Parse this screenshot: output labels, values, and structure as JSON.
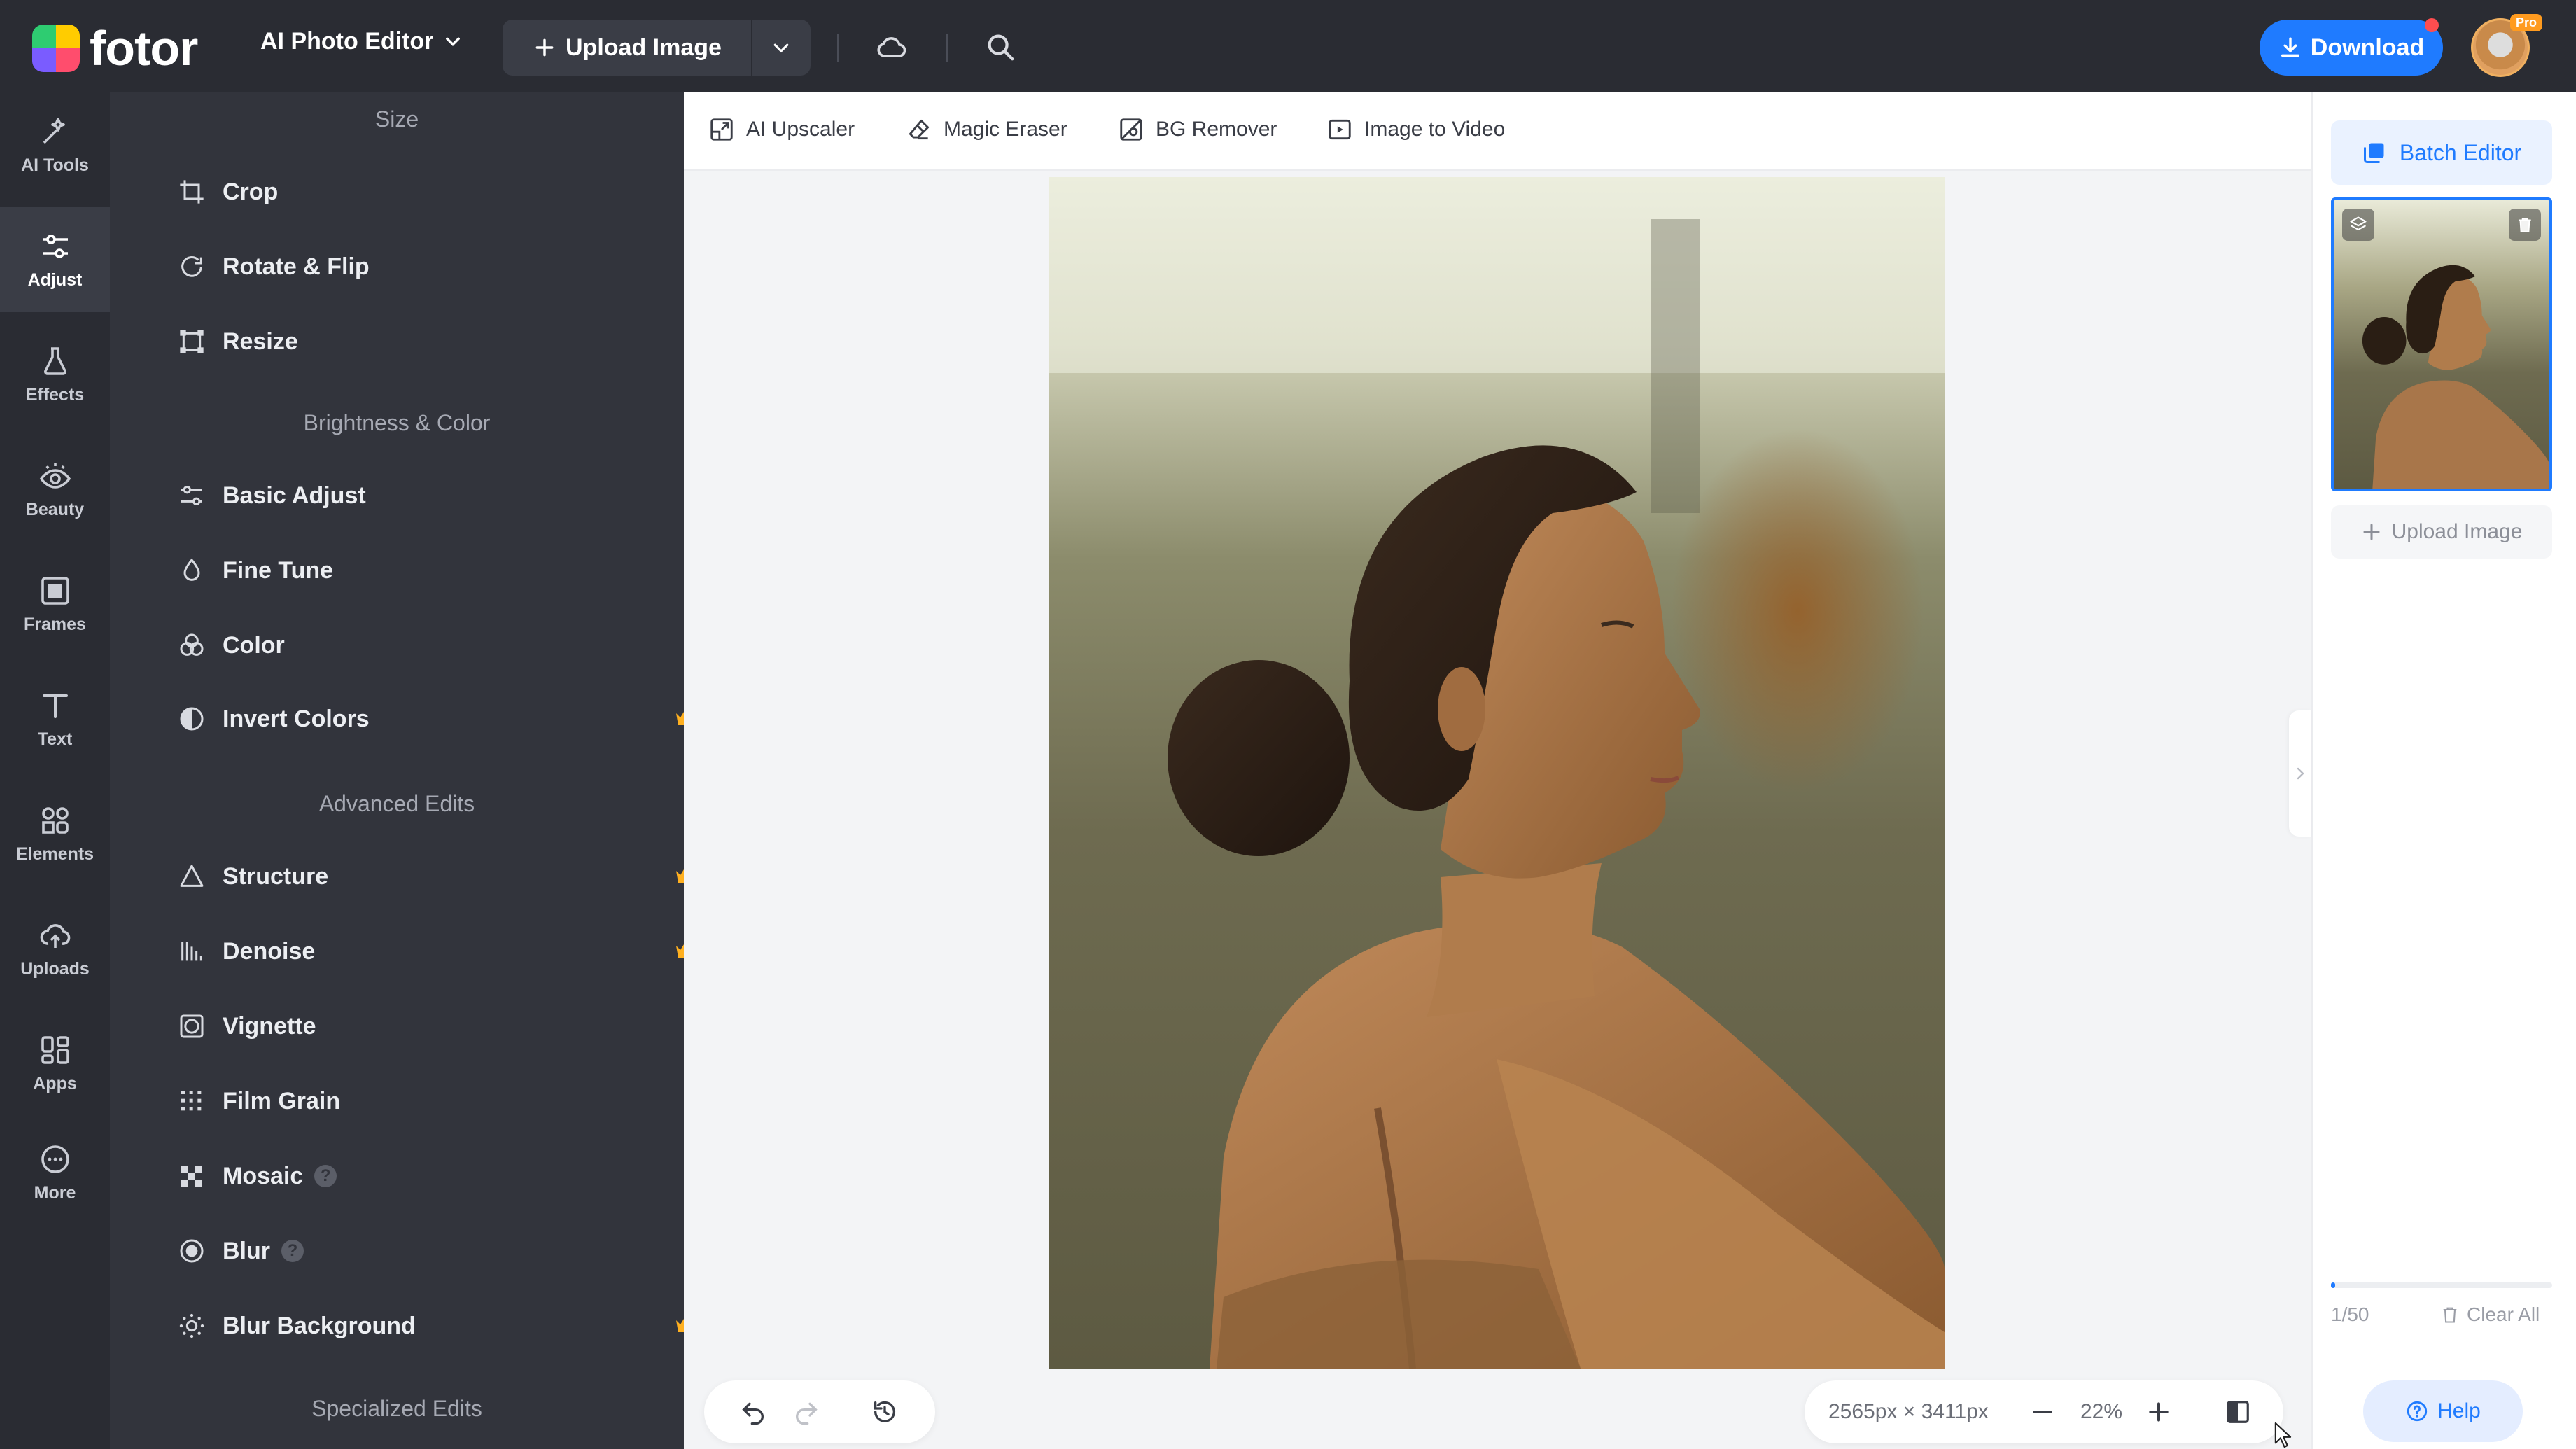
{
  "header": {
    "logo_text": "fotor",
    "editor_menu": "AI Photo Editor",
    "upload_image": "Upload Image",
    "download": "Download",
    "pro_badge": "Pro"
  },
  "rail": {
    "items": [
      {
        "label": "AI Tools",
        "icon": "sparkle-wand-icon"
      },
      {
        "label": "Adjust",
        "icon": "sliders-icon",
        "active": true
      },
      {
        "label": "Effects",
        "icon": "flask-icon"
      },
      {
        "label": "Beauty",
        "icon": "eye-icon"
      },
      {
        "label": "Frames",
        "icon": "frame-icon"
      },
      {
        "label": "Text",
        "icon": "text-icon"
      },
      {
        "label": "Elements",
        "icon": "shapes-icon"
      },
      {
        "label": "Uploads",
        "icon": "cloud-upload-icon"
      },
      {
        "label": "Apps",
        "icon": "apps-icon"
      },
      {
        "label": "More",
        "icon": "more-dots-icon"
      }
    ]
  },
  "panel": {
    "sections": {
      "size": "Size",
      "brightness": "Brightness & Color",
      "advanced": "Advanced Edits",
      "specialized": "Specialized Edits"
    },
    "tools": {
      "crop": "Crop",
      "rotate": "Rotate & Flip",
      "resize": "Resize",
      "basic_adjust": "Basic Adjust",
      "fine_tune": "Fine Tune",
      "color": "Color",
      "invert_colors": "Invert Colors",
      "structure": "Structure",
      "denoise": "Denoise",
      "vignette": "Vignette",
      "film_grain": "Film Grain",
      "mosaic": "Mosaic",
      "blur": "Blur",
      "blur_background": "Blur Background"
    },
    "invert_colors_on": false
  },
  "toolbar": {
    "ai_upscaler": "AI Upscaler",
    "magic_eraser": "Magic Eraser",
    "bg_remover": "BG Remover",
    "image_to_video": "Image to Video"
  },
  "canvas": {
    "dimensions": "2565px × 3411px",
    "zoom": "22%"
  },
  "right_panel": {
    "batch_editor": "Batch Editor",
    "upload_image": "Upload Image",
    "count": "1/50",
    "progress": 0.02,
    "clear_all": "Clear All",
    "help": "Help"
  },
  "colors": {
    "accent": "#1f7bff",
    "dark_bg": "#2a2c33",
    "panel_bg": "#32343c",
    "crown": "#ffb020"
  }
}
